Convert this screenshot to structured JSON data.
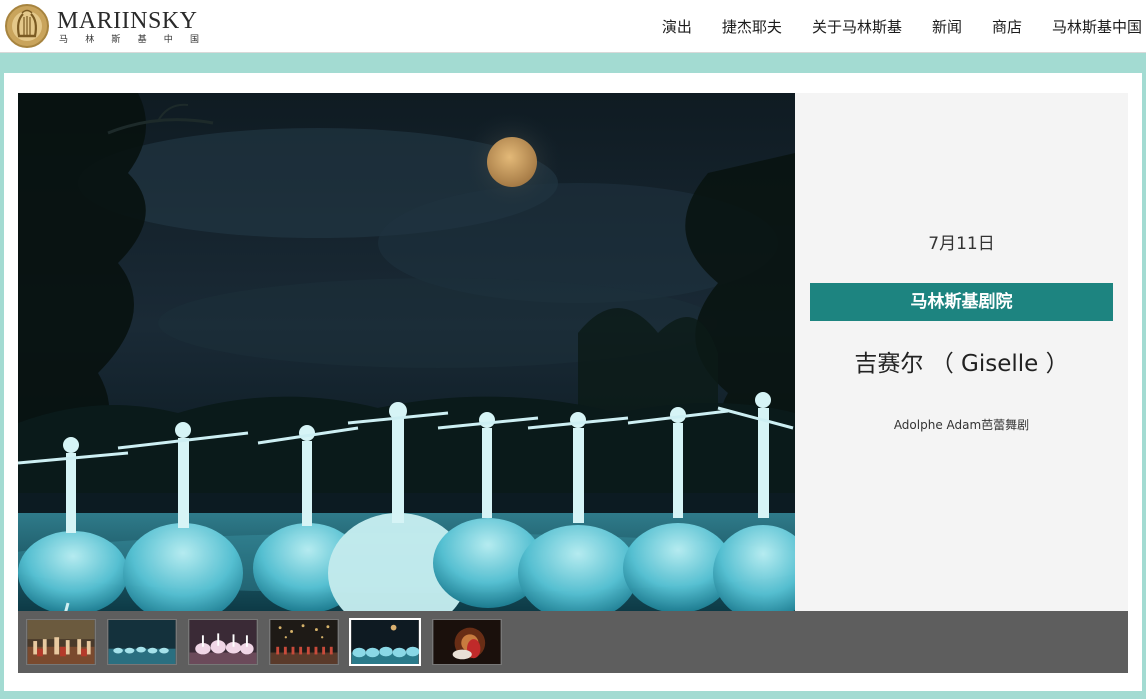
{
  "header": {
    "logo_text": "MARIINSKY",
    "logo_sub": [
      "马",
      "林",
      "斯",
      "基",
      "中",
      "国"
    ],
    "nav": [
      "演出",
      "捷杰耶夫",
      "关于马林斯基",
      "新闻",
      "商店",
      "马林斯基中国"
    ]
  },
  "event": {
    "date": "7月11日",
    "venue": "马林斯基剧院",
    "title": "吉赛尔 （ Giselle ）",
    "genre": "Adolphe Adam芭蕾舞剧"
  },
  "thumbnails": {
    "count": 6,
    "active_index": 4
  },
  "colors": {
    "page_background": "#a3dbd2",
    "venue_bar": "#1d8480",
    "info_panel": "#f4f4f4",
    "thumb_strip": "#5e5e5e"
  }
}
